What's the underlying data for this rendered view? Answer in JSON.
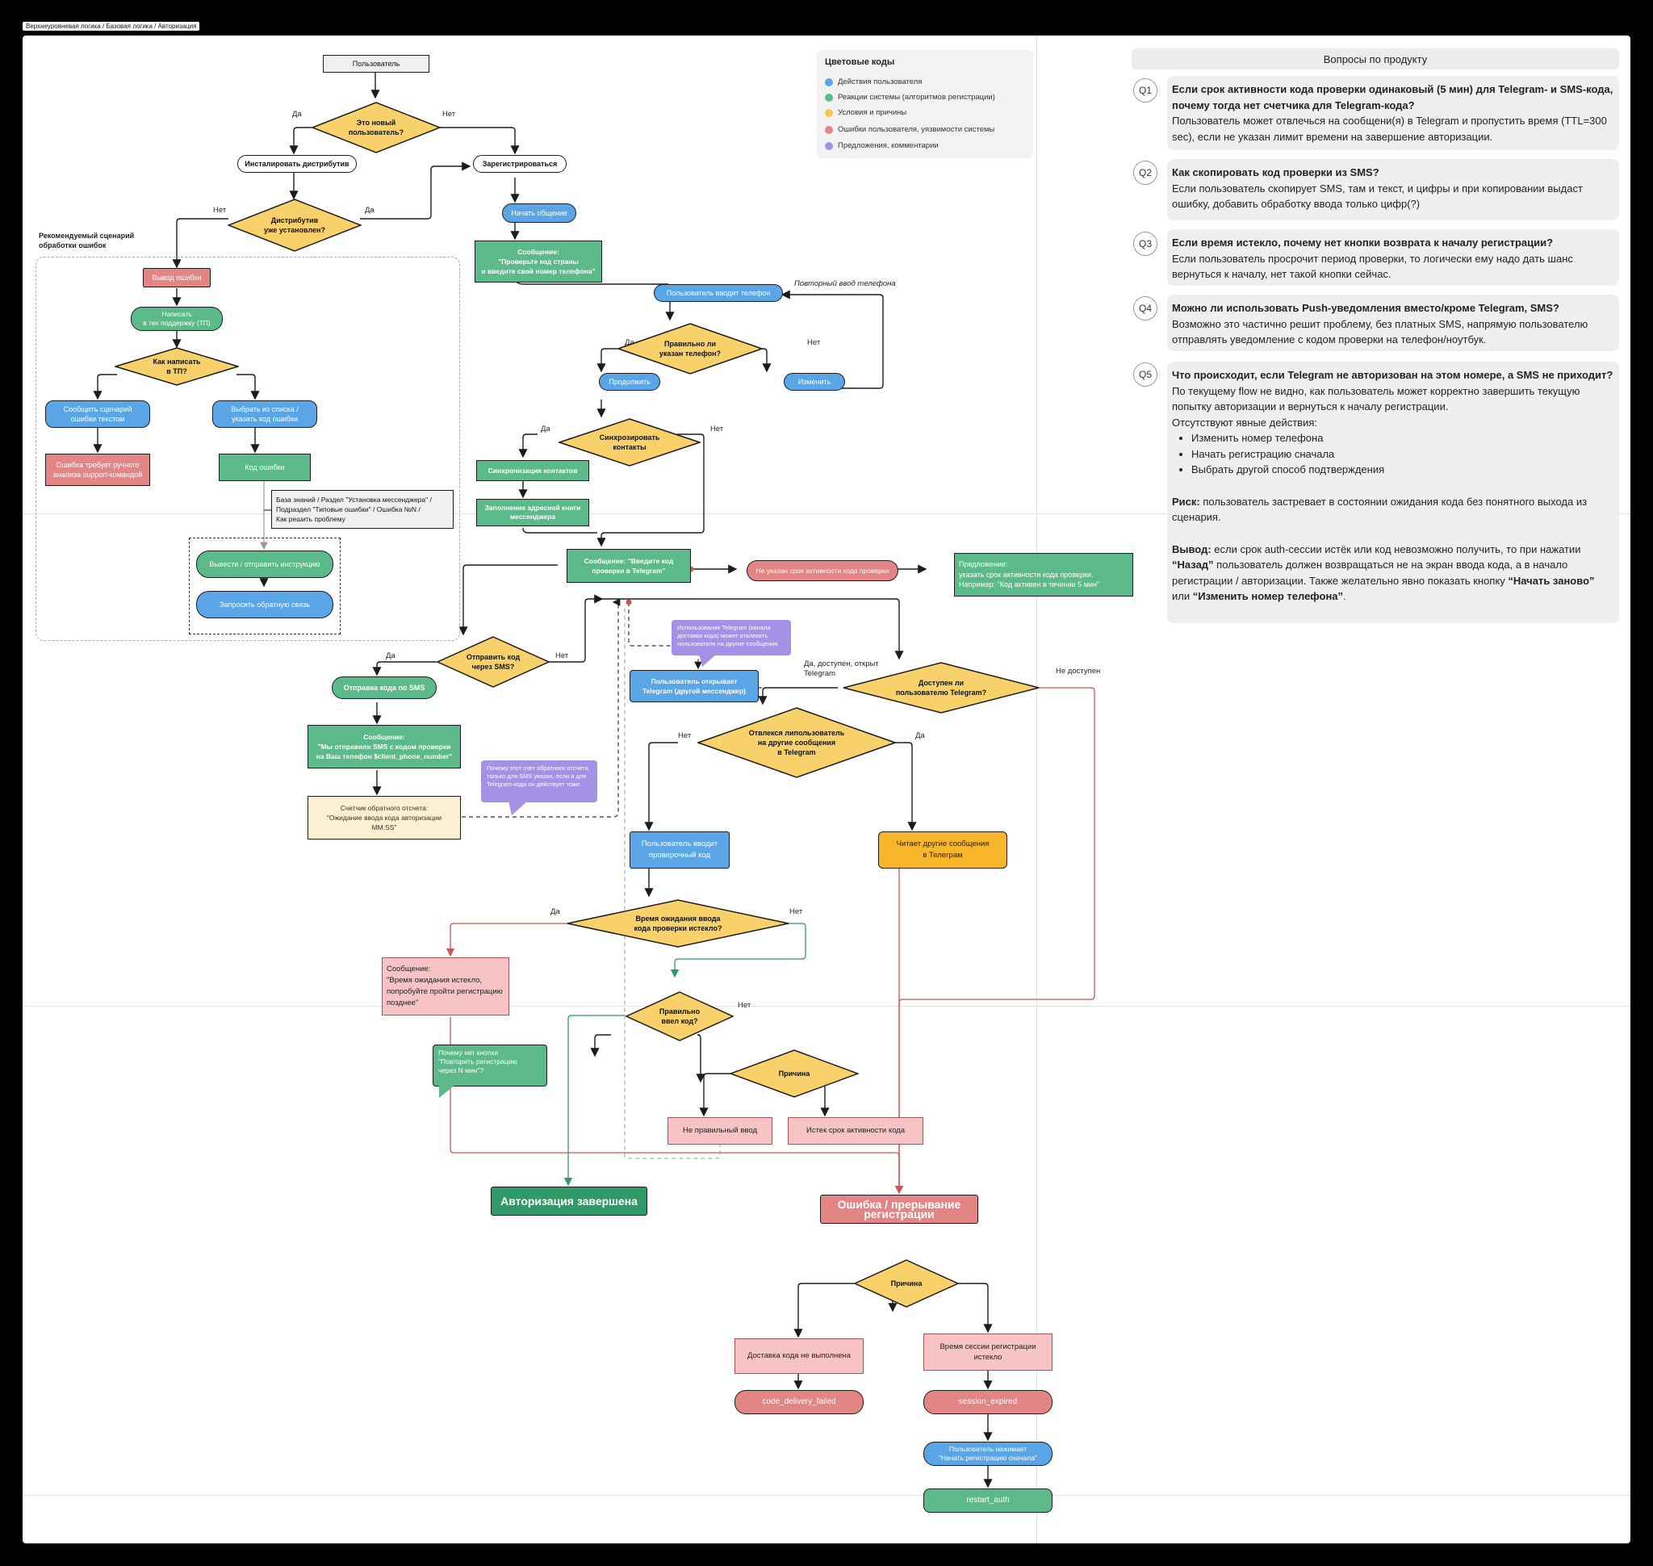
{
  "breadcrumb": "Верхнеуровневая логика / Базовая логика / Авторизация",
  "legend": {
    "title": "Цветовые коды",
    "items": [
      {
        "color": "#5aa5e6",
        "label": "Действия пользователя"
      },
      {
        "color": "#5cb98a",
        "label": "Реакции системы (алгоритмов регистрации)"
      },
      {
        "color": "#f7c84a",
        "label": "Условия и причины"
      },
      {
        "color": "#e48585",
        "label": "Ошибки пользователя, уязвимости системы"
      },
      {
        "color": "#a592e6",
        "label": "Предложения, комментарии"
      }
    ]
  },
  "flow": {
    "user": "Пользователь",
    "is_new": "Это новый\nпользователь?",
    "yes": "Да",
    "no": "Нет",
    "install": "Инсталировать дистрибутив",
    "register": "Зарегистрироваться",
    "dist_installed": "Дистрибутив\nуже установлен?",
    "start": "Начать общение",
    "msg_phone": "Сообщение:\n\"Проверьте код страны\nи введите свой номер телефона\"",
    "enter_phone": "Пользователь вводит телефон",
    "repeat_phone": "Повторный ввод телефона",
    "phone_ok": "Правильно ли\nуказан телефон?",
    "continue": "Продолжить",
    "change": "Изменить",
    "sync_q": "Синхрозировать\nконтакты",
    "sync": "Синхронизация контактов",
    "address": "Заполнение адресной книги\nмессенджера",
    "msg_code_tg": "Сообщение: \"Введите код\nпроверки в Telegram\"",
    "no_ttl": "Не указан срок активности кода проверки",
    "suggest": "Предложение:\nуказать срок активности кода проверки.\nНапример: \"Код активен в течении 5 мин\"",
    "send_sms_q": "Отправить код\nчерез SMS?",
    "sms_sending": "Отправка кода по SMS",
    "msg_sms": "Сообщение:\n\"Мы отправили SMS с кодом проверки\nна Ваш телефон $client_phone_number\"",
    "countdown": "Счетчик обратного отсчета:\n\"Ожидание ввода кода авторизации\nMM:SS\"",
    "note_countdown": "Почему этот счет обратного отсчета только для SMS указан, если и для Telegram-кода он действует тоже.",
    "note_tg": "Использование Telegram (канала доставки кода) может отвлекать пользователя на другие сообщения.",
    "user_opens_tg": "Пользователь открывает\nTelegram (другой мессенджер)",
    "avail_label": "Да, доступен, открыт\nTelegram",
    "tg_available": "Доступен ли\nпользователю Telegram?",
    "not_available": "Не доступен",
    "distracted": "Отвлекся липользователь\nна другие сообщения\nв Telegram",
    "enters_code": "Пользователь вводит\nпроверочный код",
    "reads_other": "Читает другие сообщения\nв Телеграм",
    "timeout_q": "Время ожидания ввода\nкода проверки истекло?",
    "msg_timeout": "Сообщение:\n\"Время ожидания истекло,\nпопробуйте пройти регистрацию\nпозднее\"",
    "note_retry": "Почему нет кнопки\n\"Повторить регистрацию\nчерез N мин\"?",
    "code_ok": "Правильно\nввел код?",
    "reason": "Причина",
    "wrong_input": "Не правильный ввод",
    "code_expired": "Истек срок активности кода",
    "auth_done": "Авторизация завершена",
    "reg_error": "Ошибка / прерывание регистрации",
    "reason2": "Причина",
    "delivery_failed_txt": "Доставка кода не выполнена",
    "session_expired_txt": "Время сессии регистрации\nистекло",
    "code_delivery_failed": "code_delivery_failed",
    "session_expired": "session_expired",
    "user_restart": "Пользователь нажимает\n\"Начать регистрацию сначала\"",
    "restart_auth": "restart_auth"
  },
  "errors": {
    "title": "Рекомендуемый сценарий\nобработки ошибок",
    "output": "Вывод ошибки",
    "write_tp": "Написать\nв тех поддержку (ТП)",
    "how_write": "Как написать\nв ТП?",
    "report_text": "Сообщить сценарий\nошибки текстом",
    "choose_list": "Выбрать из списка /\nуказать код ошибки",
    "manual": "Ошибка требует ручного\nанализа support-командой",
    "error_code": "Код ошибки",
    "kb": "База знаний / Раздел \"Установка мессенджера\" /\nПодраздел \"Типовые ошибки\" / Ошибка №N /\nКак решить проблему",
    "show_instruction": "Вывести / отправить инструкцию",
    "feedback": "Запросить обратную связь"
  },
  "questions": {
    "title": "Вопросы по продукту",
    "items": [
      {
        "badge": "Q1",
        "q": "Если срок активности кода проверки одинаковый (5 мин) для Telegram- и SMS-кода, почему тогда нет счетчика для Telegram-кода?",
        "a": "Пользователь может отвлечься на сообщени(я) в Telegram и пропустить время (TTL=300 sec), если не указан лимит времени на завершение авторизации."
      },
      {
        "badge": "Q2",
        "q": "Как скопировать код проверки из SMS?",
        "a": "Если пользователь скопирует SMS, там и текст, и цифры и при копировании выдаст ошибку, добавить обработку ввода только цифр(?)"
      },
      {
        "badge": "Q3",
        "q": "Если время истекло, почему нет кнопки возврата к началу регистрации?",
        "a": "Если пользователь просрочит период проверки, то логически ему надо дать шанс вернуться к началу, нет такой кнопки сейчас."
      },
      {
        "badge": "Q4",
        "q": "Можно ли использовать Push-уведомления вместо/кроме Telegram, SMS?",
        "a": "Возможно это частично решит проблему, без платных SMS, напрямую пользователю отправлять уведомление с кодом проверки на телефон/ноутбук."
      },
      {
        "badge": "Q5",
        "q": "Что происходит, если Telegram не авторизован на этом номере, а SMS не приходит?",
        "a": "По текущему flow не видно, как пользователь может корректно завершить текущую попытку авторизации и вернуться к началу регистрации.",
        "a2": "Отсутствуют явные действия:",
        "list": [
          "Изменить номер телефона",
          "Начать регистрацию сначала",
          "Выбрать другой способ подтверждения"
        ],
        "risk_label": "Риск:",
        "risk": " пользователь застревает в состоянии ожидания кода без понятного выхода из сценария.",
        "out_label": "Вывод:",
        "out_1": " если срок auth-сессии истёк или код невозможно получить, то при нажатии ",
        "out_back": "“Назад”",
        "out_2": " пользователь должен возвращаться не на экран ввода кода, а в начало регистрации / авторизации. Также желательно явно показать кнопку ",
        "out_restart": "“Начать заново”",
        "out_3": " или ",
        "out_change": "“Изменить номер телефона”",
        "out_4": "."
      }
    ]
  }
}
